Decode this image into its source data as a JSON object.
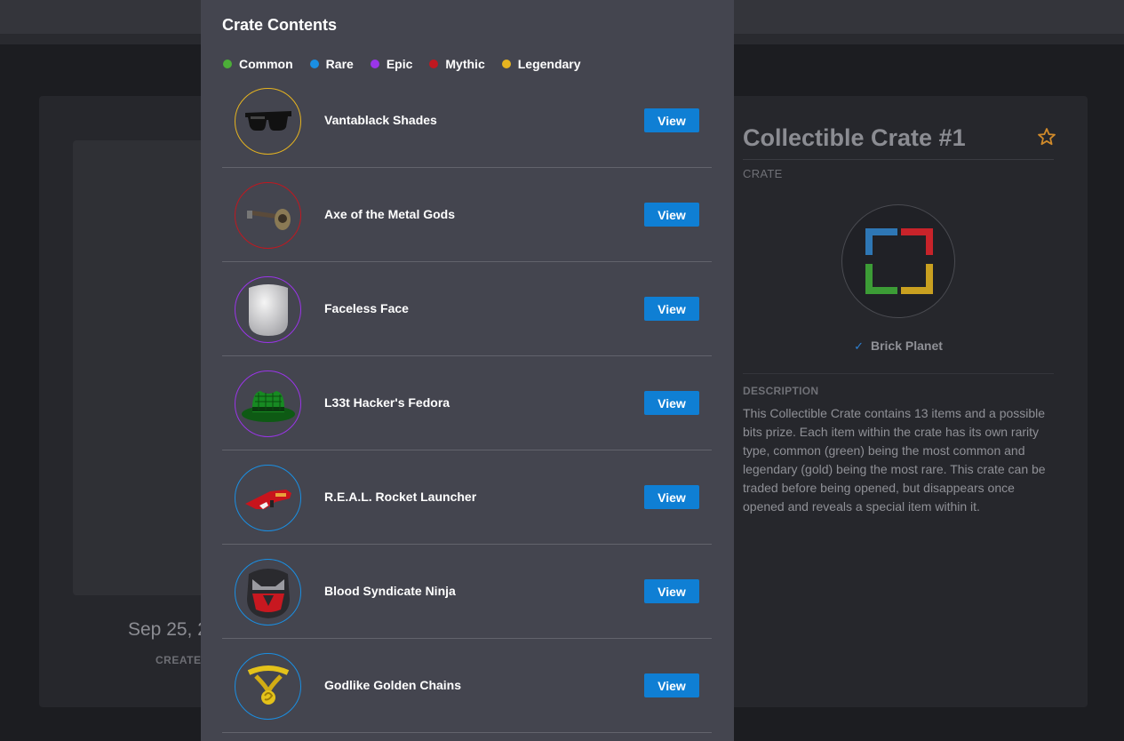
{
  "background": {
    "created_date": "Sep 25, 2",
    "created_label": "CREATED"
  },
  "details": {
    "title": "Collectible Crate #1",
    "type": "CRATE",
    "creator": "Brick Planet",
    "description_label": "DESCRIPTION",
    "description": "This Collectible Crate contains 13 items and a possible bits prize. Each item within the crate has its own rarity type, common (green) being the most common and legendary (gold) being the most rare. This crate can be traded before being opened, but disappears once opened and reveals a special item within it."
  },
  "modal": {
    "title": "Crate Contents",
    "legend": [
      {
        "label": "Common",
        "color": "#4cae38"
      },
      {
        "label": "Rare",
        "color": "#1a8fe3"
      },
      {
        "label": "Epic",
        "color": "#9a35e8"
      },
      {
        "label": "Mythic",
        "color": "#c01820"
      },
      {
        "label": "Legendary",
        "color": "#e6b420"
      }
    ],
    "items": [
      {
        "name": "Vantablack Shades",
        "rarity_color": "#e6b420",
        "icon": "sunglasses-icon",
        "button": "View"
      },
      {
        "name": "Axe of the Metal Gods",
        "rarity_color": "#c01820",
        "icon": "axe-icon",
        "button": "View"
      },
      {
        "name": "Faceless Face",
        "rarity_color": "#9a35e8",
        "icon": "face-icon",
        "button": "View"
      },
      {
        "name": "L33t Hacker's Fedora",
        "rarity_color": "#9a35e8",
        "icon": "fedora-icon",
        "button": "View"
      },
      {
        "name": "R.E.A.L. Rocket Launcher",
        "rarity_color": "#1a8fe3",
        "icon": "rocket-launcher-icon",
        "button": "View"
      },
      {
        "name": "Blood Syndicate Ninja",
        "rarity_color": "#1a8fe3",
        "icon": "ninja-mask-icon",
        "button": "View"
      },
      {
        "name": "Godlike Golden Chains",
        "rarity_color": "#1a8fe3",
        "icon": "gold-chain-icon",
        "button": "View"
      }
    ]
  }
}
